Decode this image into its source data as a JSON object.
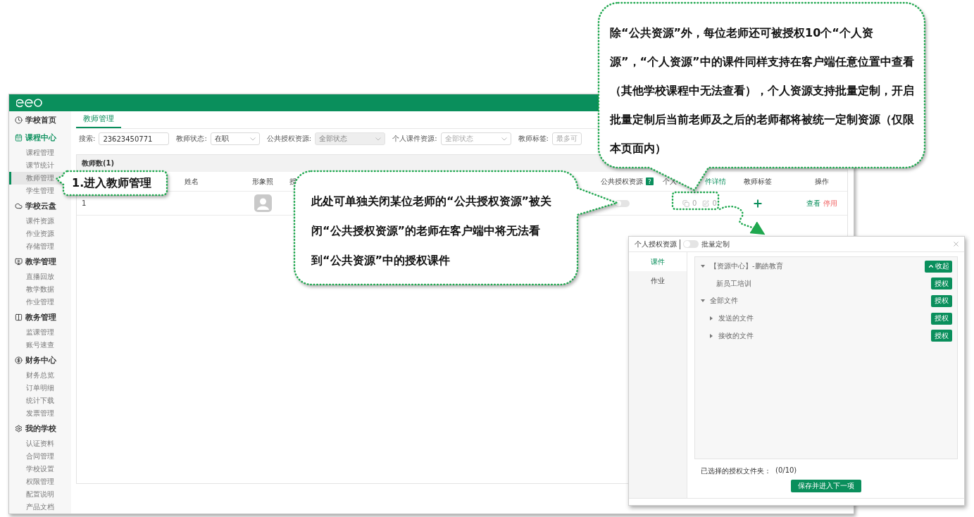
{
  "sidebar": {
    "groups": [
      {
        "label": "学校首页",
        "active": false
      },
      {
        "label": "课程中心",
        "active": true,
        "items": [
          {
            "label": "课程管理",
            "selected": false
          },
          {
            "label": "课节统计",
            "selected": false
          },
          {
            "label": "教师管理",
            "selected": true
          },
          {
            "label": "学生管理",
            "selected": false
          }
        ]
      },
      {
        "label": "学校云盘",
        "active": false,
        "items": [
          {
            "label": "课件资源",
            "selected": false
          },
          {
            "label": "作业资源",
            "selected": false
          },
          {
            "label": "存储管理",
            "selected": false
          }
        ]
      },
      {
        "label": "教学管理",
        "active": false,
        "items": [
          {
            "label": "直播回放",
            "selected": false
          },
          {
            "label": "教学数据",
            "selected": false
          },
          {
            "label": "作业管理",
            "selected": false
          }
        ]
      },
      {
        "label": "教务管理",
        "active": false,
        "items": [
          {
            "label": "监课管理",
            "selected": false
          },
          {
            "label": "账号速查",
            "selected": false
          }
        ]
      },
      {
        "label": "财务中心",
        "active": false,
        "items": [
          {
            "label": "财务总览",
            "selected": false
          },
          {
            "label": "订单明细",
            "selected": false
          },
          {
            "label": "统计下载",
            "selected": false
          },
          {
            "label": "发票管理",
            "selected": false
          }
        ]
      },
      {
        "label": "我的学校",
        "active": false,
        "items": [
          {
            "label": "认证资料",
            "selected": false
          },
          {
            "label": "合同管理",
            "selected": false
          },
          {
            "label": "学校设置",
            "selected": false
          },
          {
            "label": "权限管理",
            "selected": false
          },
          {
            "label": "配置说明",
            "selected": false
          },
          {
            "label": "产品文档",
            "selected": false
          }
        ]
      }
    ]
  },
  "tabs": [
    {
      "label": "教师管理",
      "selected": true
    }
  ],
  "filters": [
    {
      "label": "搜索:",
      "kind": "text",
      "value": "23623450771",
      "disabled": false
    },
    {
      "label": "教师状态:",
      "kind": "select",
      "value": "在职",
      "disabled": false
    },
    {
      "label": "公共授权资源:",
      "kind": "select",
      "placeholder": "全部状态",
      "disabled": true
    },
    {
      "label": "个人课件资源:",
      "kind": "select",
      "placeholder": "全部状态",
      "disabled": false
    },
    {
      "label": "教师标签:",
      "kind": "text",
      "placeholder": "最多可",
      "disabled": false
    }
  ],
  "table": {
    "count_title": "教师数(1)",
    "columns": [
      {
        "label": "姓名",
        "kind": "plain"
      },
      {
        "label": "形象照",
        "kind": "plain"
      },
      {
        "label": "授",
        "kind": "plain"
      },
      {
        "label": "公共授权资源",
        "kind": "plain",
        "help": "?"
      },
      {
        "label": "个人",
        "kind": "plain"
      },
      {
        "label": "件详情",
        "kind": "link"
      },
      {
        "label": "教师标签",
        "kind": "plain"
      },
      {
        "label": "操作",
        "kind": "plain"
      }
    ],
    "rows": [
      {
        "index": "1",
        "public_resource_on": false,
        "courseware_count": "0",
        "homework_count": "0",
        "actions": [
          {
            "label": "查看",
            "kind": "view"
          },
          {
            "label": "停用",
            "kind": "disable"
          }
        ]
      }
    ]
  },
  "dialog": {
    "title": "个人授权资源",
    "batch": {
      "label": "批量定制",
      "on": false
    },
    "tabs": [
      {
        "label": "课件",
        "selected": true
      },
      {
        "label": "作业",
        "selected": false
      }
    ],
    "tree": [
      {
        "label": "【资源中心】-鹏皓教育",
        "expanded": true,
        "action": {
          "kind": "collapse",
          "label": "收起"
        },
        "children": [
          {
            "label": "新员工培训",
            "action": {
              "kind": "grant",
              "label": "授权"
            }
          }
        ]
      },
      {
        "label": "全部文件",
        "expanded": true,
        "action": {
          "kind": "grant",
          "label": "授权"
        },
        "children": [
          {
            "label": "发送的文件",
            "expanded": false,
            "action": {
              "kind": "grant",
              "label": "授权"
            }
          },
          {
            "label": "接收的文件",
            "expanded": false,
            "action": {
              "kind": "grant",
              "label": "授权"
            }
          }
        ]
      }
    ],
    "selected_label": "已选择的授权文件夹：",
    "selected_count": "(0/10)",
    "submit": "保存并进入下一项"
  },
  "callouts": [
    {
      "text": "除“公共资源”外，每位老师还可被授权10个“个人资源”，“个人资源”中的课件同样支持在客户端任意位置中查看（其他学校课程中无法查看），个人资源支持批量定制，开启批量定制后当前老师及之后的老师都将被统一定制资源（仅限本页面内）"
    },
    {
      "text": "1.进入教师管理"
    },
    {
      "text": "此处可单独关闭某位老师的“公共授权资源”被关闭“公共授权资源”的老师在客户端中将无法看到“公共资源”中的授权课件"
    }
  ]
}
